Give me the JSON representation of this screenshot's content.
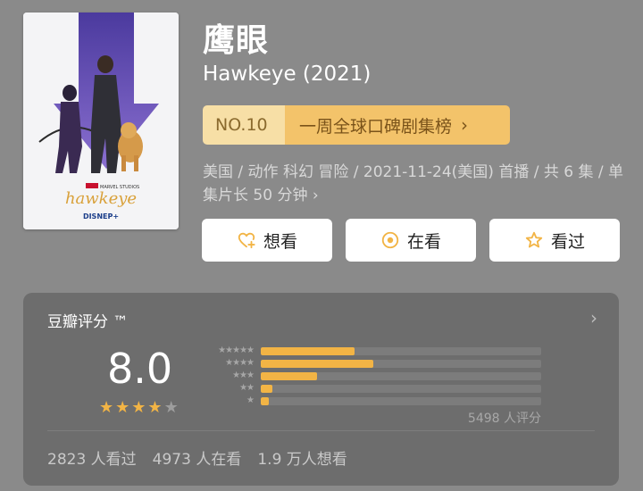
{
  "show": {
    "title_cn": "鹰眼",
    "title_en": "Hawkeye (2021)",
    "poster": {
      "logo": "hawkeye",
      "studio": "MARVEL STUDIOS",
      "network": "DISNEP+"
    }
  },
  "rank": {
    "number": "NO.10",
    "list_name": "一周全球口碑剧集榜"
  },
  "meta": {
    "text": "美国 / 动作 科幻 冒险 / 2021-11-24(美国) 首播 / 共 6 集 / 单集片长 50 分钟",
    "more": "›"
  },
  "actions": [
    {
      "label": "想看",
      "icon": "heart-plus-icon"
    },
    {
      "label": "在看",
      "icon": "circle-dot-icon"
    },
    {
      "label": "看过",
      "icon": "star-outline-icon"
    }
  ],
  "rating": {
    "card_title": "豆瓣评分 ™",
    "score": "8.0",
    "stars_filled": 4,
    "stars_total": 5,
    "distribution": [
      {
        "stars": "★★★★★",
        "fraction": 0.335
      },
      {
        "stars": "★★★★",
        "fraction": 0.4
      },
      {
        "stars": "★★★",
        "fraction": 0.2
      },
      {
        "stars": "★★",
        "fraction": 0.04
      },
      {
        "stars": "★",
        "fraction": 0.03
      }
    ],
    "votes": "5498 人评分",
    "stats": [
      "2823 人看过",
      "4973 人在看",
      "1.9 万人想看"
    ]
  },
  "colors": {
    "accent": "#f2b445",
    "background": "#8a8a8a",
    "card": "#6d6d6d"
  }
}
